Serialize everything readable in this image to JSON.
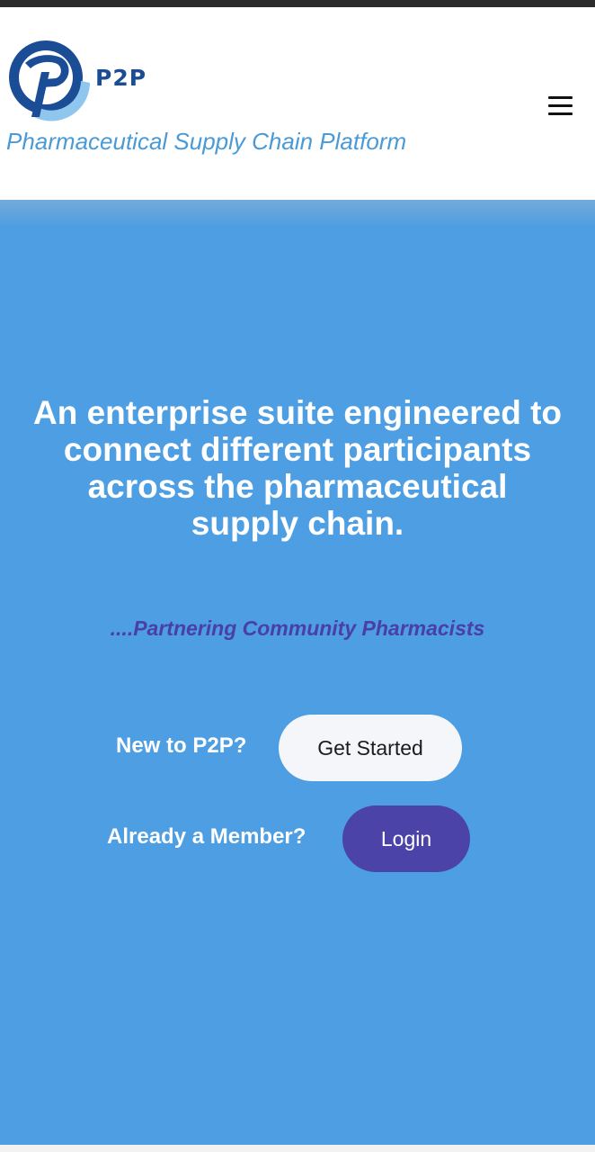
{
  "header": {
    "brand_name": "P2P",
    "tagline": "Pharmaceutical Supply Chain Platform",
    "menu_icon": "hamburger-menu-icon",
    "logo_icon": "p2p-logo-icon"
  },
  "hero": {
    "headline_lines": [
      "An enterprise suite engineered to",
      "connect different participants",
      "across the pharmaceutical",
      "supply chain."
    ],
    "slogan": "....Partnering Community Pharmacists",
    "new_user_prompt": "New to P2P?",
    "get_started_label": "Get Started",
    "member_prompt": "Already a Member?",
    "login_label": "Login"
  },
  "colors": {
    "hero_background": "#4d9ee2",
    "brand_dark_blue": "#1a4d95",
    "tagline_blue": "#4a9ad6",
    "slogan_purple": "#4a3fa8",
    "login_button": "#4b43a8",
    "get_started_button": "#f4f6f9"
  }
}
